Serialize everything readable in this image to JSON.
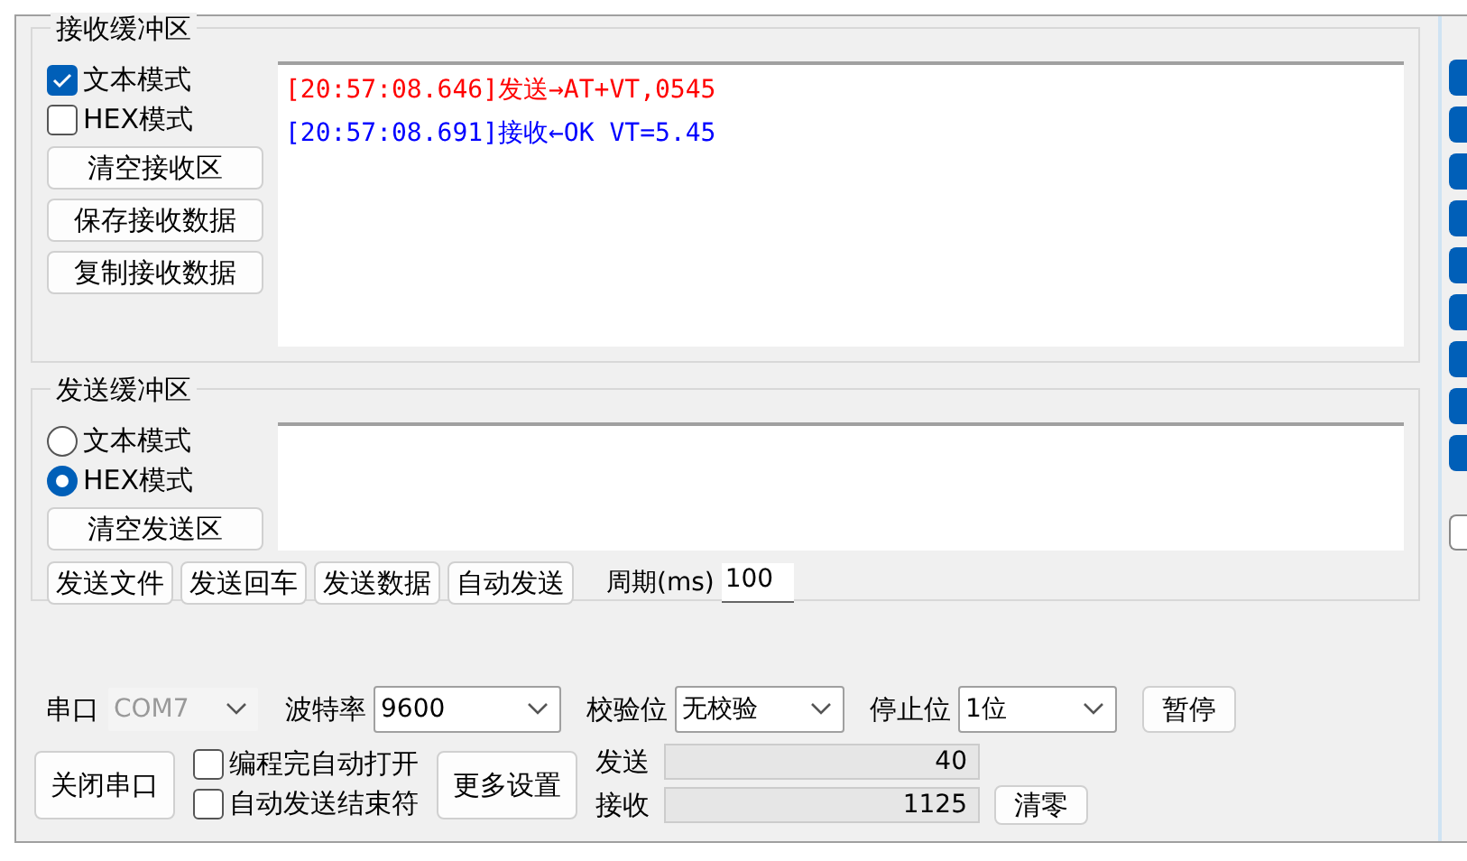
{
  "receive": {
    "title": "接收缓冲区",
    "modes": [
      {
        "label": "文本模式",
        "kind": "checkbox",
        "checked": true
      },
      {
        "label": "HEX模式",
        "kind": "checkbox",
        "checked": false
      }
    ],
    "buttons": [
      "清空接收区",
      "保存接收数据",
      "复制接收数据"
    ],
    "log": [
      {
        "text": "[20:57:08.646]发送→AT+VT,0545",
        "color": "#ff0000"
      },
      {
        "text": "[20:57:08.691]接收←OK VT=5.45",
        "color": "#0000ff"
      }
    ]
  },
  "send": {
    "title": "发送缓冲区",
    "modes": [
      {
        "label": "文本模式",
        "selected": false
      },
      {
        "label": "HEX模式",
        "selected": true
      }
    ],
    "clear_button": "清空发送区",
    "actions": [
      "发送文件",
      "发送回车",
      "发送数据",
      "自动发送"
    ],
    "period": {
      "label": "周期(ms)",
      "value": "100"
    }
  },
  "settings": {
    "port": {
      "label": "串口",
      "value": "COM7",
      "disabled": true
    },
    "baud": {
      "label": "波特率",
      "value": "9600",
      "disabled": false
    },
    "parity": {
      "label": "校验位",
      "value": "无校验",
      "disabled": false
    },
    "stop": {
      "label": "停止位",
      "value": "1位",
      "disabled": false
    },
    "pause_button": "暂停",
    "close_button": "关闭串口",
    "options": [
      {
        "label": "编程完自动打开",
        "checked": false
      },
      {
        "label": "自动发送结束符",
        "checked": false
      }
    ],
    "more_button": "更多设置",
    "counters": [
      {
        "label": "发送",
        "value": "40"
      },
      {
        "label": "接收",
        "value": "1125"
      }
    ],
    "reset_button": "清零"
  },
  "side_checks": [
    {
      "checked": true
    },
    {
      "checked": true
    },
    {
      "checked": true
    },
    {
      "checked": true
    },
    {
      "checked": true
    },
    {
      "checked": true
    },
    {
      "checked": true
    },
    {
      "checked": true
    },
    {
      "checked": true
    },
    {
      "checked": false
    }
  ]
}
